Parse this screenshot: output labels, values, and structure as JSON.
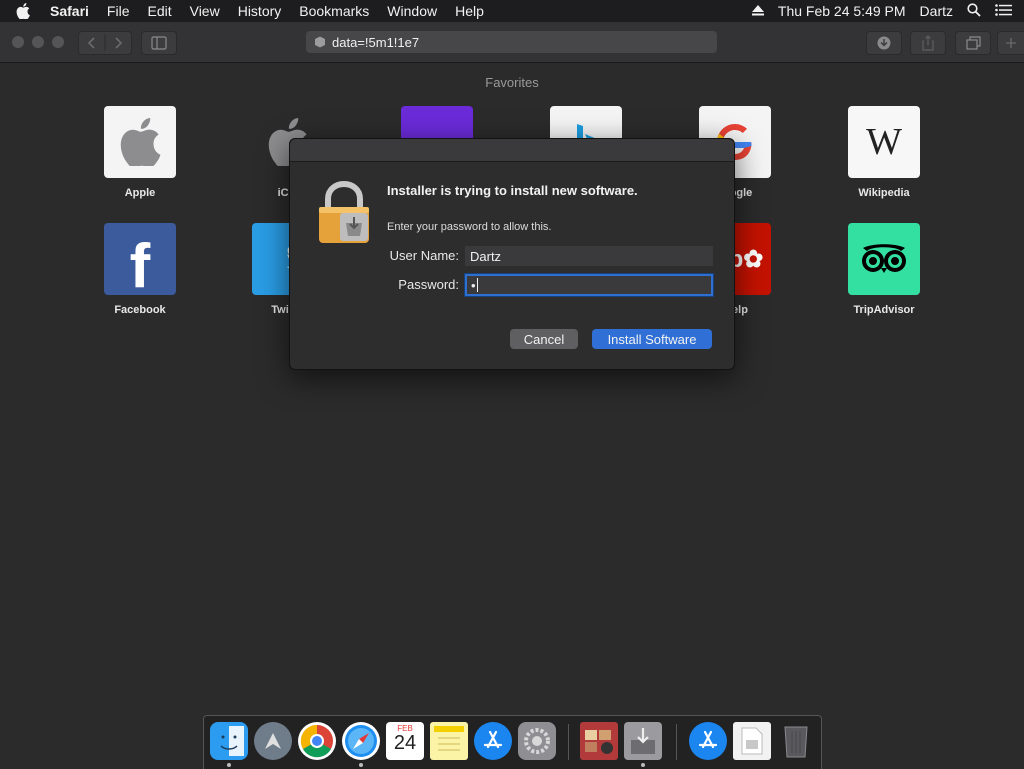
{
  "menubar": {
    "app": "Safari",
    "items": [
      "File",
      "Edit",
      "View",
      "History",
      "Bookmarks",
      "Window",
      "Help"
    ],
    "clock": "Thu Feb 24  5:49 PM",
    "user": "Dartz"
  },
  "toolbar": {
    "url": "data=!5m1!1e7"
  },
  "favorites": {
    "title": "Favorites",
    "row1": [
      "Apple",
      "iClo",
      "Yahoo",
      "Bing",
      "ogle",
      "Wikipedia"
    ],
    "row2": [
      "Facebook",
      "Twi",
      "",
      "",
      "elp",
      "TripAdvisor"
    ]
  },
  "dialog": {
    "title": "Installer is trying to install new software.",
    "message": "Enter your password to allow this.",
    "username_label": "User Name:",
    "username_value": "Dartz",
    "password_label": "Password:",
    "password_value": "•",
    "cancel_label": "Cancel",
    "confirm_label": "Install Software"
  },
  "dock": {
    "calendar_month": "FEB",
    "calendar_day": "24"
  },
  "colors": {
    "accent": "#2f6fd6",
    "background": "#2b2b2c"
  }
}
